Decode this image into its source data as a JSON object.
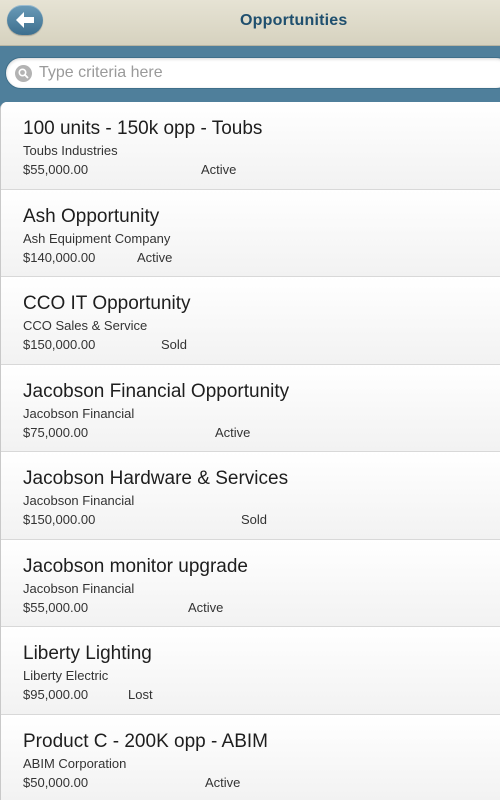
{
  "header": {
    "title": "Opportunities",
    "back_icon": "back-arrow-icon"
  },
  "search": {
    "placeholder": "Type criteria here",
    "value": "",
    "icon": "search-icon"
  },
  "opportunities": [
    {
      "name": "100 units - 150k opp - Toubs",
      "company": "Toubs Industries",
      "amount": "$55,000.00",
      "status": "Active"
    },
    {
      "name": "Ash Opportunity",
      "company": "Ash Equipment Company",
      "amount": "$140,000.00",
      "status": "Active"
    },
    {
      "name": "CCO IT Opportunity",
      "company": "CCO Sales & Service",
      "amount": "$150,000.00",
      "status": "Sold"
    },
    {
      "name": "Jacobson Financial Opportunity",
      "company": "Jacobson Financial",
      "amount": "$75,000.00",
      "status": "Active"
    },
    {
      "name": "Jacobson Hardware & Services",
      "company": "Jacobson Financial",
      "amount": "$150,000.00",
      "status": "Sold"
    },
    {
      "name": "Jacobson monitor upgrade",
      "company": "Jacobson Financial",
      "amount": "$55,000.00",
      "status": "Active"
    },
    {
      "name": "Liberty Lighting",
      "company": "Liberty Electric",
      "amount": "$95,000.00",
      "status": "Lost"
    },
    {
      "name": "Product C - 200K opp - ABIM",
      "company": "ABIM Corporation",
      "amount": "$50,000.00",
      "status": "Active"
    }
  ],
  "colors": {
    "header_bg": "#dedbca",
    "title_color": "#1f4f6e",
    "search_bar_bg": "#4f7f9b",
    "back_button": "#4f86a6"
  }
}
